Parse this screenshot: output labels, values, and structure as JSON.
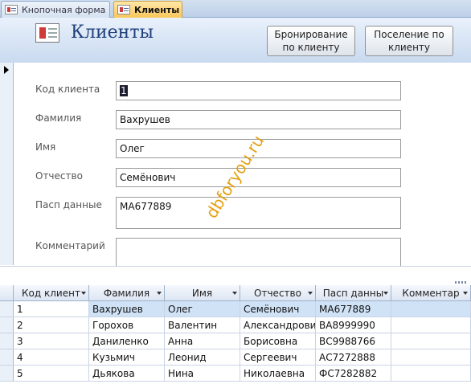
{
  "tabs": [
    {
      "label": "Кнопочная форма",
      "active": false
    },
    {
      "label": "Клиенты",
      "active": true
    }
  ],
  "form": {
    "title": "Клиенты",
    "buttons": {
      "booking": {
        "line1": "Бронирование",
        "line2": "по клиенту"
      },
      "settlement": {
        "line1": "Поселение по",
        "line2": "клиенту"
      }
    },
    "fields": {
      "client_code": {
        "label": "Код клиента",
        "value": "1"
      },
      "last_name": {
        "label": "Фамилия",
        "value": "Вахрушев"
      },
      "first_name": {
        "label": "Имя",
        "value": "Олег"
      },
      "patronymic": {
        "label": "Отчество",
        "value": "Семёнович"
      },
      "passport": {
        "label": "Пасп данные",
        "value": "МА677889"
      },
      "comment": {
        "label": "Комментарий",
        "value": ""
      }
    }
  },
  "watermark": "dbforyou.ru",
  "datasheet": {
    "columns": [
      "Код клиент",
      "Фамилия",
      "Имя",
      "Отчество",
      "Пасп данны",
      "Комментар"
    ],
    "rows": [
      {
        "code": "1",
        "last_name": "Вахрушев",
        "first_name": "Олег",
        "patronymic": "Семёнович",
        "passport": "МА677889",
        "comment": ""
      },
      {
        "code": "2",
        "last_name": "Горохов",
        "first_name": "Валентин",
        "patronymic": "Александрови",
        "passport": "ВА8999990",
        "comment": ""
      },
      {
        "code": "3",
        "last_name": "Даниленко",
        "first_name": "Анна",
        "patronymic": "Борисовна",
        "passport": "ВС9988766",
        "comment": ""
      },
      {
        "code": "4",
        "last_name": "Кузьмич",
        "first_name": "Леонид",
        "patronymic": "Сергеевич",
        "passport": "АС7272888",
        "comment": ""
      },
      {
        "code": "5",
        "last_name": "Дьякова",
        "first_name": "Нина",
        "patronymic": "Николаевна",
        "passport": "ФС7282882",
        "comment": ""
      }
    ]
  },
  "colors": {
    "active_tab": "#f9c75a",
    "header_gradient_top": "#e9f1fb",
    "header_gradient_bottom": "#c9daf0",
    "title": "#1f3f7a",
    "watermark": "#e4a012",
    "selected_row": "#cfe2f6"
  }
}
